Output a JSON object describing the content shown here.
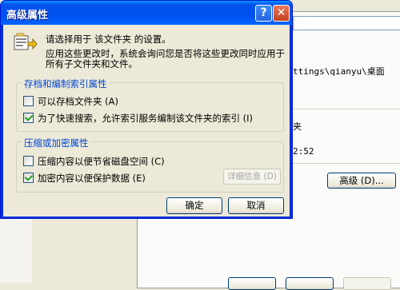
{
  "dialog": {
    "title": "高级属性",
    "intro": "请选择用于 该文件夹 的设置。",
    "note_line1": "应用这些更改时，系统会询问您是否将这些更改同时应用于",
    "note_line2": "所有子文件夹和文件。",
    "archive_group": {
      "legend": "存档和编制索引属性",
      "archive_label": "可以存档文件夹 (A)",
      "archive_checked": false,
      "index_label": "为了快速搜索，允许索引服务编制该文件夹的索引 (I)",
      "index_checked": true
    },
    "compress_group": {
      "legend": "压缩或加密属性",
      "compress_label": "压缩内容以便节省磁盘空间 (C)",
      "compress_checked": false,
      "encrypt_label": "加密内容以便保护数据 (E)",
      "encrypt_checked": true,
      "details_label": "详细信息 (D)"
    },
    "ok_label": "确定",
    "cancel_label": "取消",
    "help_glyph": "?",
    "close_glyph": "✕"
  },
  "background_window": {
    "location_text": "ttings\\qianyu\\桌面",
    "partial_text": "夹",
    "time_text": "2:52",
    "advanced_label": "高级 (D)..."
  },
  "icons": [
    "folder-settings-icon",
    "help-icon",
    "close-icon"
  ]
}
